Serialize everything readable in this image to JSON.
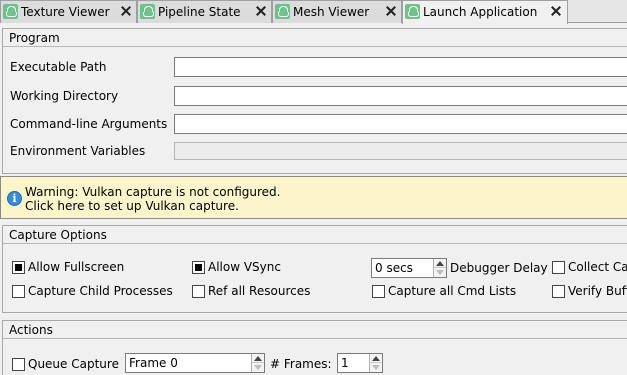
{
  "tabs": [
    {
      "label": "Texture Viewer",
      "icon": "texture-viewer-icon"
    },
    {
      "label": "Pipeline State",
      "icon": "pipeline-state-icon"
    },
    {
      "label": "Mesh Viewer",
      "icon": "mesh-viewer-icon"
    },
    {
      "label": "Launch Application",
      "icon": "launch-application-icon",
      "active": true
    }
  ],
  "program": {
    "title": "Program",
    "executable_label": "Executable Path",
    "executable_value": "",
    "working_dir_label": "Working Directory",
    "working_dir_value": "",
    "cmdline_label": "Command-line Arguments",
    "cmdline_value": "",
    "env_label": "Environment Variables",
    "env_value": ""
  },
  "warning": {
    "line1": "Warning: Vulkan capture is not configured.",
    "line2": "Click here to set up Vulkan capture.",
    "icon": "info-icon",
    "background": "#fcf5cc"
  },
  "capture_options": {
    "title": "Capture Options",
    "allow_fullscreen": {
      "label": "Allow Fullscreen",
      "checked": true
    },
    "allow_vsync": {
      "label": "Allow VSync",
      "checked": true
    },
    "debugger_delay": {
      "value": "0 secs",
      "label": "Debugger Delay"
    },
    "collect_callstacks": {
      "label": "Collect Ca",
      "checked": false
    },
    "capture_child": {
      "label": "Capture Child Processes",
      "checked": false
    },
    "ref_all_resources": {
      "label": "Ref all Resources",
      "checked": false
    },
    "capture_cmd_lists": {
      "label": "Capture all Cmd Lists",
      "checked": false
    },
    "verify_buffer": {
      "label": "Verify Buff",
      "checked": false
    }
  },
  "actions": {
    "title": "Actions",
    "queue_capture": {
      "label": "Queue Capture",
      "checked": false
    },
    "frame_value": "Frame 0",
    "frames_label": "# Frames:",
    "frames_value": "1"
  }
}
